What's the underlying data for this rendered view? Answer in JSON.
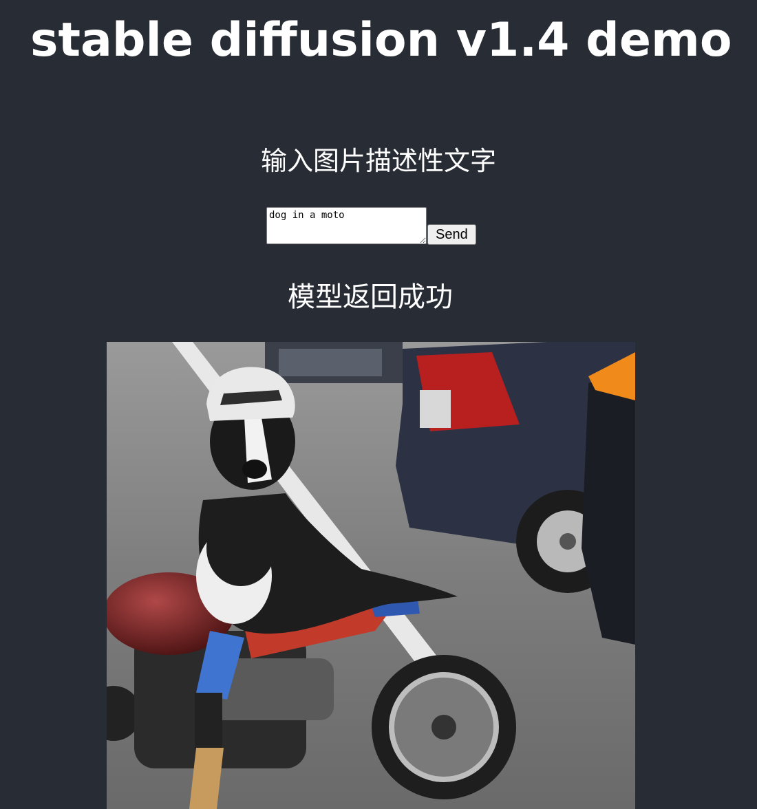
{
  "header": {
    "title": "stable diffusion v1.4 demo"
  },
  "prompt_section": {
    "heading": "输入图片描述性文字",
    "textarea_value": "dog in a moto",
    "send_label": "Send"
  },
  "result_section": {
    "status": "模型返回成功",
    "image_subject": "dog wearing a helmet on a red motorcycle next to parked cars"
  },
  "colors": {
    "background": "#282c34",
    "text": "#ffffff"
  }
}
